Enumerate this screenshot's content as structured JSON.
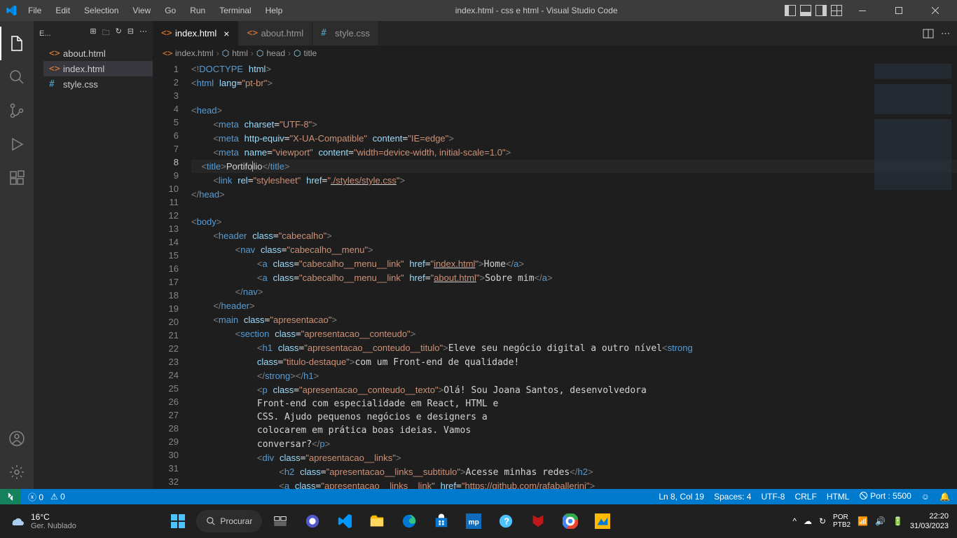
{
  "titlebar": {
    "menus": [
      "File",
      "Edit",
      "Selection",
      "View",
      "Go",
      "Run",
      "Terminal",
      "Help"
    ],
    "title": "index.html - css e html - Visual Studio Code"
  },
  "sidebar": {
    "header": "E...",
    "files": [
      {
        "name": "about.html",
        "type": "html",
        "active": false
      },
      {
        "name": "index.html",
        "type": "html",
        "active": true
      },
      {
        "name": "style.css",
        "type": "css",
        "active": false
      }
    ]
  },
  "tabs": [
    {
      "name": "index.html",
      "type": "html",
      "active": true,
      "close": true
    },
    {
      "name": "about.html",
      "type": "html",
      "active": false,
      "close": false
    },
    {
      "name": "style.css",
      "type": "css",
      "active": false,
      "close": false
    }
  ],
  "breadcrumb": [
    "index.html",
    "html",
    "head",
    "title"
  ],
  "code": {
    "lines": 32,
    "cursor_line": 8
  },
  "statusbar": {
    "errors": "0",
    "warnings": "0",
    "position": "Ln 8, Col 19",
    "spaces": "Spaces: 4",
    "encoding": "UTF-8",
    "eol": "CRLF",
    "lang": "HTML",
    "port": "Port : 5500"
  },
  "taskbar": {
    "temp": "16°C",
    "weather": "Ger. Nublado",
    "search": "Procurar",
    "time": "22:20",
    "date": "31/03/2023"
  }
}
